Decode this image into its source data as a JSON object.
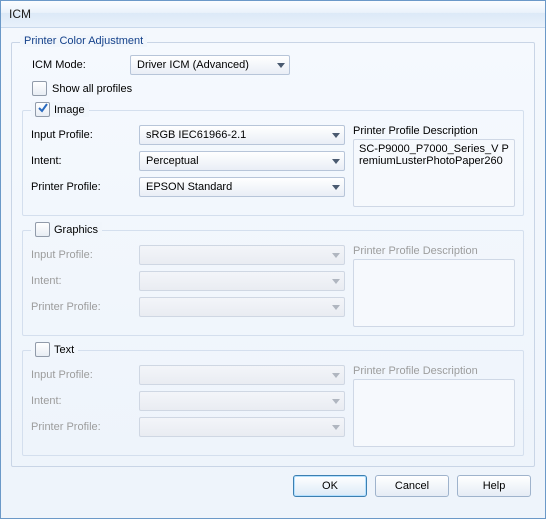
{
  "window": {
    "title": "ICM"
  },
  "group": {
    "title": "Printer Color Adjustment"
  },
  "mode": {
    "label": "ICM Mode:",
    "value": "Driver ICM (Advanced)"
  },
  "show_all": {
    "label": "Show all profiles",
    "checked": false
  },
  "labels": {
    "input_profile": "Input Profile:",
    "intent": "Intent:",
    "printer_profile": "Printer Profile:",
    "desc": "Printer Profile Description"
  },
  "image": {
    "legend": "Image",
    "checked": true,
    "input_profile": "sRGB IEC61966-2.1",
    "intent": "Perceptual",
    "printer_profile": "EPSON Standard",
    "desc": "SC-P9000_P7000_Series_V PremiumLusterPhotoPaper260"
  },
  "graphics": {
    "legend": "Graphics",
    "checked": false,
    "input_profile": "",
    "intent": "",
    "printer_profile": "",
    "desc": ""
  },
  "text": {
    "legend": "Text",
    "checked": false,
    "input_profile": "",
    "intent": "",
    "printer_profile": "",
    "desc": ""
  },
  "buttons": {
    "ok": "OK",
    "cancel": "Cancel",
    "help": "Help"
  }
}
